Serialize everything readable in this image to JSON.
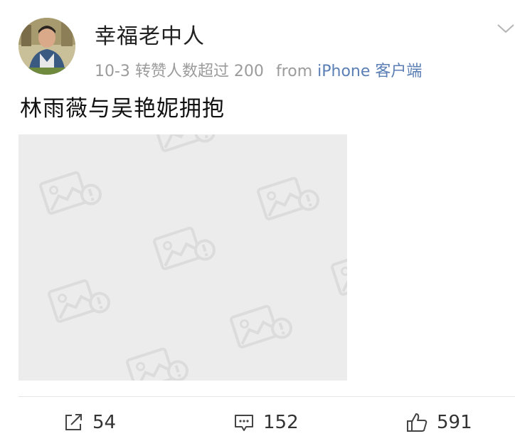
{
  "post": {
    "username": "幸福老中人",
    "date": "10-3",
    "reposts_note": "转赞人数超过 200",
    "from_label": "from",
    "source": "iPhone 客户端",
    "text": "林雨薇与吴艳妮拥抱"
  },
  "icons": {
    "more": "chevron-down-icon",
    "image_placeholder": "image-placeholder-icon",
    "share": "share-icon",
    "comment": "comment-icon",
    "like": "thumbs-up-icon"
  },
  "actions": {
    "share_count": "54",
    "comment_count": "152",
    "like_count": "591"
  },
  "colors": {
    "source_link": "#5b7fb5",
    "meta_text": "#9b9b9b",
    "image_placeholder_bg": "#ececec"
  }
}
